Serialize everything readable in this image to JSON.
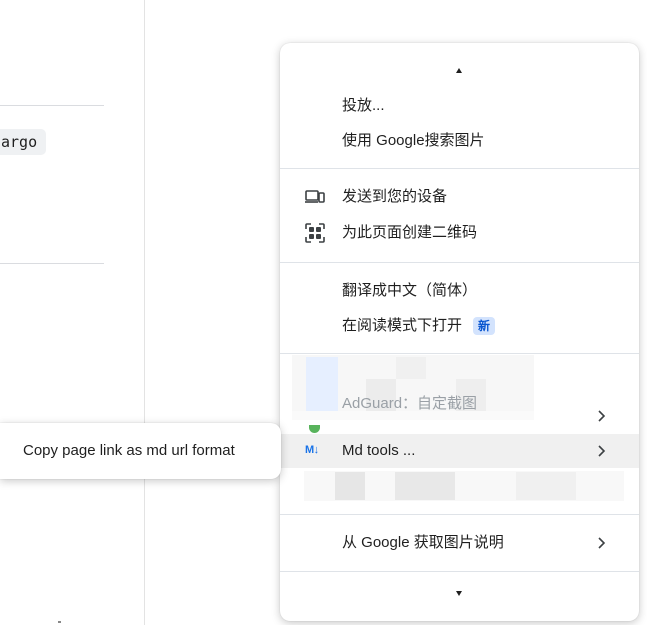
{
  "background": {
    "code_snippet": "argo"
  },
  "menu": {
    "items": [
      {
        "label": "投放..."
      },
      {
        "label": "使用 Google搜索图片"
      },
      {
        "label": "发送到您的设备",
        "icon": "devices-icon"
      },
      {
        "label": "为此页面创建二维码",
        "icon": "qr-code-icon"
      },
      {
        "label": "翻译成中文（简体）"
      },
      {
        "label": "在阅读模式下打开",
        "badge": "新"
      },
      {
        "label": "AdGuard：自定截图",
        "icon": "adguard-icon"
      },
      {
        "label": "Md tools ...",
        "icon": "markdown-icon",
        "icon_text": "M↓"
      },
      {
        "label": "从 Google 获取图片说明"
      }
    ]
  },
  "submenu": {
    "items": [
      {
        "label": "Copy page link as md url format"
      }
    ]
  },
  "colors": {
    "accent": "#1a73e8",
    "badge_bg": "#d3e3fd",
    "badge_text": "#0b57d0",
    "hover_bg": "#f0f0f0",
    "separator": "#dfe3e8"
  }
}
